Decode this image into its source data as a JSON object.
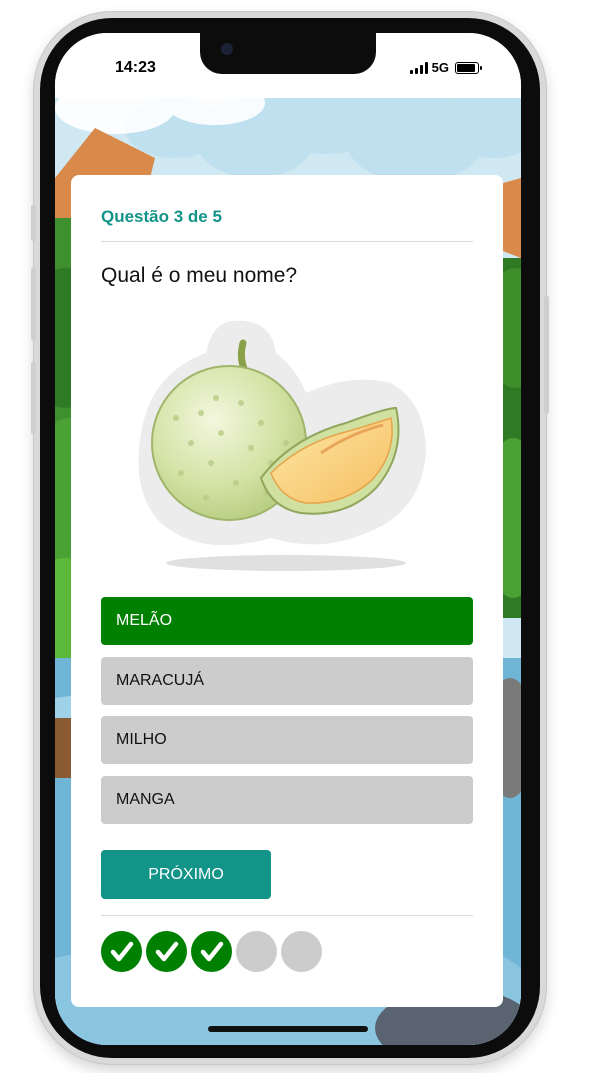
{
  "status_bar": {
    "time": "14:23",
    "network": "5G"
  },
  "quiz": {
    "header": "Questão 3 de 5",
    "question": "Qual é o meu nome?",
    "image_subject": "melon-image",
    "options": [
      {
        "label": "MELÃO",
        "selected": true
      },
      {
        "label": "MARACUJÁ",
        "selected": false
      },
      {
        "label": "MILHO",
        "selected": false
      },
      {
        "label": "MANGA",
        "selected": false
      }
    ],
    "next_label": "PRÓXIMO",
    "progress": [
      "done",
      "done",
      "done",
      "pending",
      "pending"
    ]
  },
  "colors": {
    "accent": "#129488",
    "selected": "#008000",
    "option_bg": "#cccccc",
    "progress_pending": "#cccccc"
  }
}
